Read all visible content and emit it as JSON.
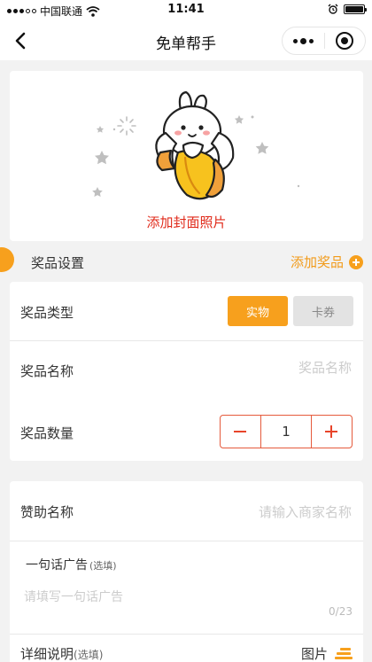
{
  "status_bar": {
    "carrier": "中国联通",
    "time": "11:41"
  },
  "nav": {
    "title": "免单帮手"
  },
  "cover": {
    "label": "添加封面照片"
  },
  "prize_section": {
    "title": "奖品设置",
    "add_label": "添加奖品"
  },
  "prize": {
    "type_label": "奖品类型",
    "type_options": [
      "实物",
      "卡券"
    ],
    "type_selected": "实物",
    "name_label": "奖品名称",
    "name_placeholder": "奖品名称",
    "quantity_label": "奖品数量",
    "quantity_value": "1"
  },
  "sponsor": {
    "name_label": "赞助名称",
    "name_placeholder": "请输入商家名称",
    "ad_label": "一句话广告",
    "ad_optional": "(选填)",
    "ad_placeholder": "请填写一句话广告",
    "ad_counter": "0/23",
    "detail_label": "详细说明",
    "detail_optional": "(选填)",
    "image_label": "图片"
  },
  "colors": {
    "accent": "#f7a01d",
    "red": "#e02a1a",
    "stepper": "#e55a3c"
  }
}
